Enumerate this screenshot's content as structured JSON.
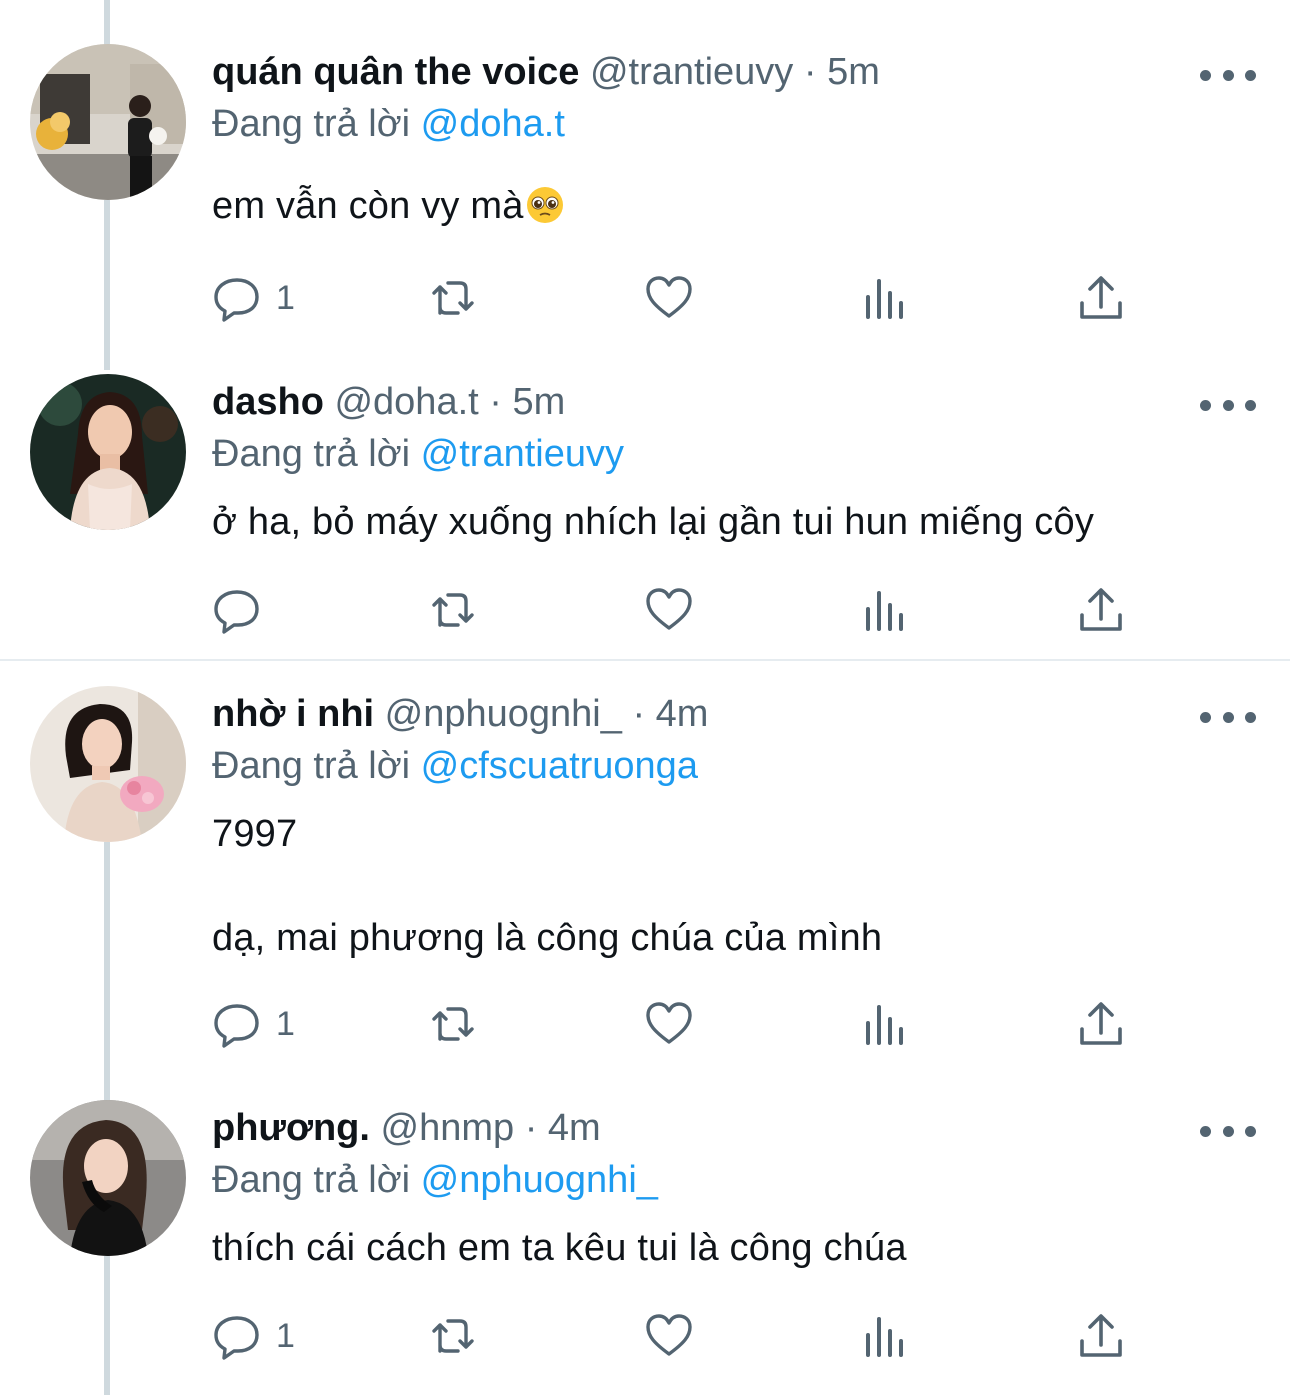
{
  "tweets": [
    {
      "name": "quán quân the voice",
      "handle": "@trantieuvy",
      "separator": "·",
      "time": "5m",
      "reply_prefix": "Đang trả lời",
      "reply_to": "@doha.t",
      "lines": [
        "em vẫn còn vy mà"
      ],
      "emoji": "pleading-face",
      "reply_count": "1"
    },
    {
      "name": "dasho",
      "handle": "@doha.t",
      "separator": "·",
      "time": "5m",
      "reply_prefix": "Đang trả lời",
      "reply_to": "@trantieuvy",
      "lines": [
        "ở ha, bỏ máy xuống nhích lại gần tui hun miếng côy"
      ],
      "reply_count": ""
    },
    {
      "name": "nhờ i nhi",
      "handle": "@nphuognhi_",
      "separator": "·",
      "time": "4m",
      "reply_prefix": "Đang trả lời",
      "reply_to": "@cfscuatruonga",
      "lines": [
        "7997",
        "dạ, mai phương là công chúa của mình"
      ],
      "reply_count": "1"
    },
    {
      "name": "phương.",
      "handle": "@hnmp",
      "separator": "·",
      "time": "4m",
      "reply_prefix": "Đang trả lời",
      "reply_to": "@nphuognhi_",
      "lines": [
        "thích cái cách em ta kêu tui là công chúa"
      ],
      "reply_count": "1"
    }
  ],
  "icons": {
    "reply": "reply-icon",
    "retweet": "retweet-icon",
    "like": "heart-icon",
    "views": "analytics-icon",
    "share": "share-icon",
    "more": "more-icon"
  },
  "colors": {
    "mention": "#1d9bf0",
    "secondary": "#536471",
    "thread_line": "#cfd9de",
    "divider": "#e6ecf0"
  }
}
